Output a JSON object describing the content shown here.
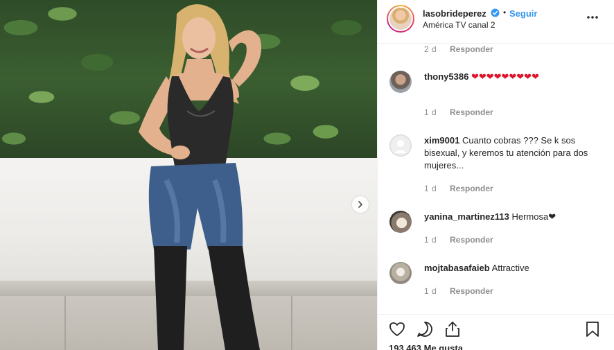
{
  "post": {
    "username": "lasobrideperez",
    "separator": "•",
    "follow_label": "Seguir",
    "location": "América TV canal 2",
    "likes_count": "193.463",
    "likes_label": "Me gusta"
  },
  "comments": [
    {
      "user": "",
      "text": "",
      "time": "2 d",
      "reply": "Responder"
    },
    {
      "user": "thony5386",
      "text": "❤❤❤❤❤❤❤❤❤",
      "time": "1 d",
      "reply": "Responder"
    },
    {
      "user": "xim9001",
      "text": "Cuanto cobras ??? Se k sos bisexual, y keremos tu atención para dos mujeres...",
      "time": "1 d",
      "reply": "Responder"
    },
    {
      "user": "yanina_martinez113",
      "text": "Hermosa❤",
      "time": "1 d",
      "reply": "Responder"
    },
    {
      "user": "mojtabasafaieb",
      "text": "Attractive",
      "time": "1 d",
      "reply": "Responder"
    }
  ],
  "icons": {
    "verified": "verified-badge-icon",
    "more": "more-options-icon",
    "like": "heart-icon",
    "comment": "comment-icon",
    "share": "share-icon",
    "save": "bookmark-icon",
    "next": "chevron-right-icon"
  },
  "colors": {
    "link_blue": "#3897f0",
    "heart_red": "#e0152b",
    "meta_gray": "#8e8e8e"
  }
}
